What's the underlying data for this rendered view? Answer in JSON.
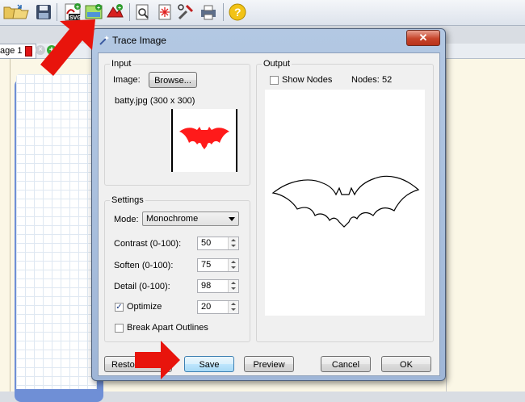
{
  "toolbar": {
    "icons": [
      "open-folder-icon",
      "save-disk-icon",
      "import-svg-icon",
      "trace-image-icon",
      "warp-shape-icon",
      "page-preview-icon",
      "laser-icon",
      "tools-icon",
      "print-icon",
      "help-icon"
    ]
  },
  "tabs": [
    {
      "label": "age 1",
      "swatch_color": "#e01414"
    }
  ],
  "dialog": {
    "title": "Trace Image",
    "close_label": "✕",
    "input": {
      "group_label": "Input",
      "image_label": "Image:",
      "browse_label": "Browse...",
      "file_info": "batty.jpg (300 x 300)"
    },
    "output": {
      "group_label": "Output",
      "show_nodes_label": "Show Nodes",
      "show_nodes_checked": false,
      "nodes_label": "Nodes:",
      "nodes_value": "52"
    },
    "settings": {
      "group_label": "Settings",
      "mode_label": "Mode:",
      "mode_value": "Monochrome",
      "contrast_label": "Contrast (0-100):",
      "contrast_value": "50",
      "soften_label": "Soften (0-100):",
      "soften_value": "75",
      "detail_label": "Detail (0-100):",
      "detail_value": "98",
      "optimize_label": "Optimize",
      "optimize_checked": true,
      "optimize_value": "20",
      "break_apart_label": "Break Apart Outlines",
      "break_apart_checked": false
    },
    "buttons": {
      "restore": "Restore",
      "save": "Save",
      "preview": "Preview",
      "cancel": "Cancel",
      "ok": "OK"
    }
  },
  "colors": {
    "accent_red": "#e8140c",
    "bat_fill": "#ff1a1a",
    "mat_blue": "#6f8fd6",
    "dialog_frame": "#b3c8e3"
  }
}
